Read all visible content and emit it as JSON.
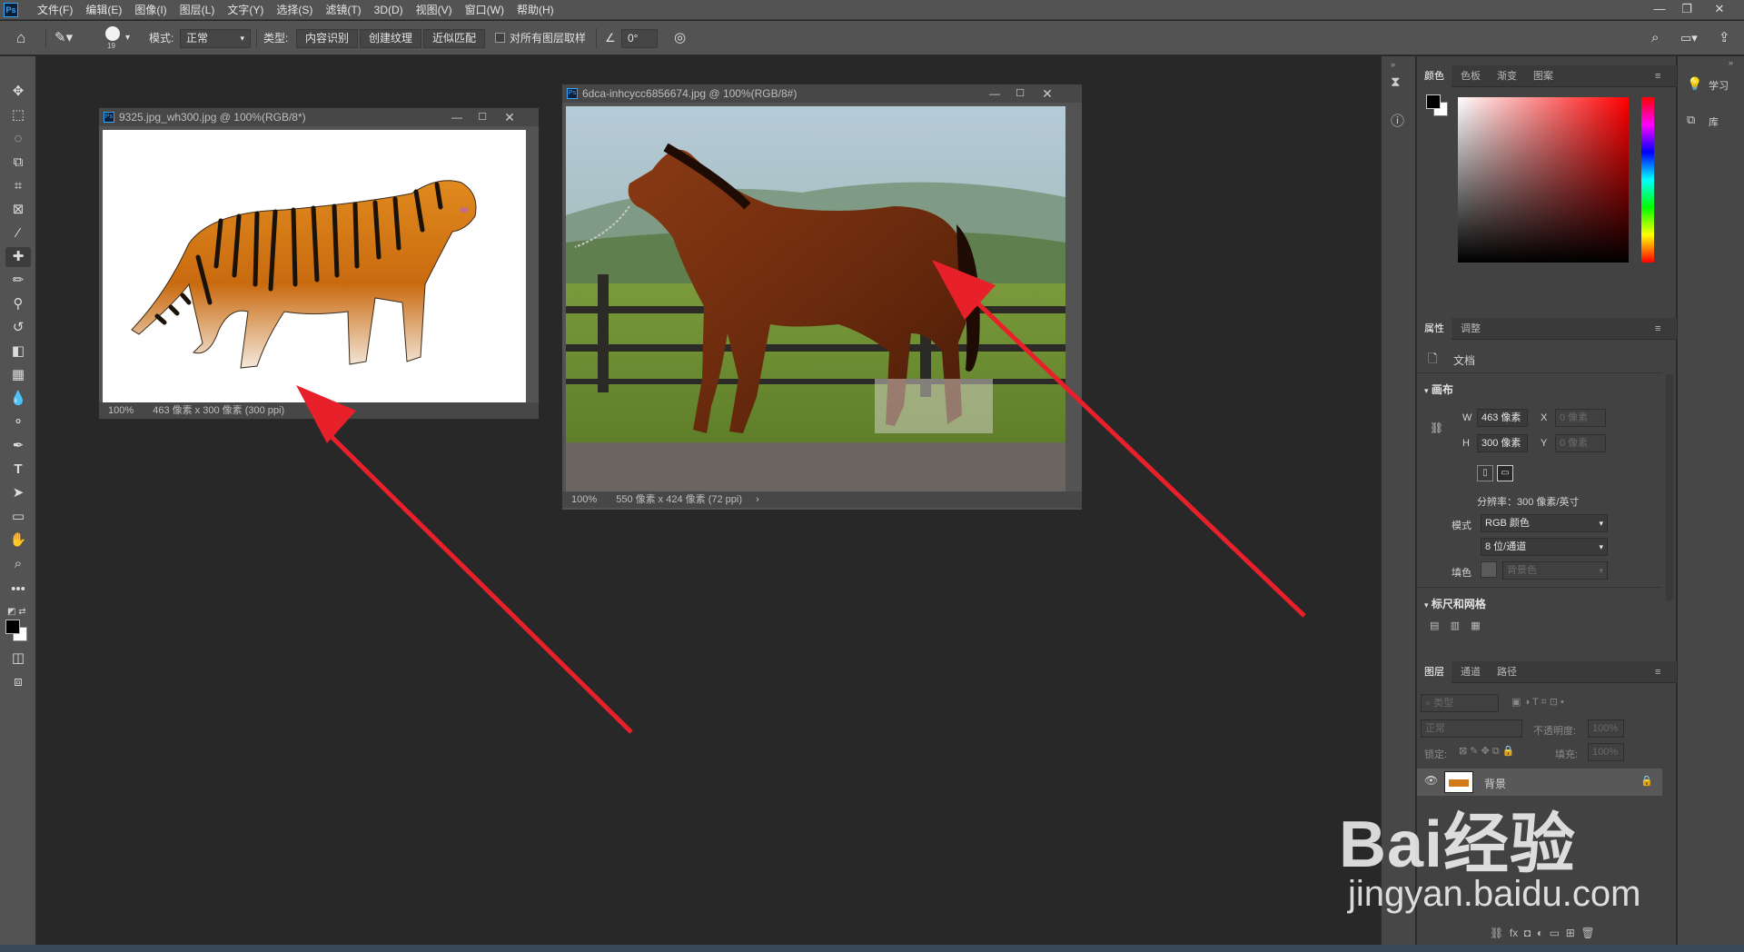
{
  "menubar": {
    "logo": "Ps",
    "items": [
      "文件(F)",
      "编辑(E)",
      "图像(I)",
      "图层(L)",
      "文字(Y)",
      "选择(S)",
      "滤镜(T)",
      "3D(D)",
      "视图(V)",
      "窗口(W)",
      "帮助(H)"
    ],
    "window_controls": [
      "—",
      "❐",
      "✕"
    ]
  },
  "options": {
    "brush_size": "19",
    "mode_label": "模式:",
    "mode_value": "正常",
    "type_label": "类型:",
    "type_buttons": [
      "内容识别",
      "创建纹理",
      "近似匹配"
    ],
    "sample_all_layers": "对所有图层取样",
    "angle_value": "0°"
  },
  "documents": [
    {
      "title": "9325.jpg_wh300.jpg @ 100%(RGB/8*)",
      "zoom": "100%",
      "info": "463 像素 x 300 像素 (300 ppi)",
      "image_icon": "tiger-image"
    },
    {
      "title": "6dca-inhcycc6856674.jpg @ 100%(RGB/8#)",
      "zoom": "100%",
      "info": "550 像素 x 424 像素 (72 ppi)",
      "image_icon": "horse-image"
    }
  ],
  "color_panel": {
    "tabs": [
      "颜色",
      "色板",
      "渐变",
      "图案"
    ],
    "foreground": "#000000",
    "background": "#ffffff",
    "hue": "#ff0000"
  },
  "properties_panel": {
    "tabs": [
      "属性",
      "调整"
    ],
    "doc_label": "文档",
    "canvas_header": "画布",
    "w_label": "W",
    "w_value": "463 像素",
    "h_label": "H",
    "h_value": "300 像素",
    "x_label": "X",
    "x_placeholder": "0 像素",
    "y_label": "Y",
    "y_placeholder": "0 像素",
    "resolution": "分辨率：300 像素/英寸",
    "mode_label": "模式",
    "mode_value": "RGB 颜色",
    "depth_value": "8 位/通道",
    "fill_label": "填色",
    "fill_value": "背景色",
    "rulers_header": "标尺和网格"
  },
  "layers_panel": {
    "tabs": [
      "图层",
      "通道",
      "路径"
    ],
    "filter_placeholder": "类型",
    "blend_mode": "正常",
    "opacity_label": "不透明度:",
    "opacity_value": "100%",
    "lock_label": "锁定:",
    "fill_label": "填充:",
    "fill_value": "100%",
    "layer_name": "背景"
  },
  "right_strip": {
    "learn_label": "学习",
    "library_label": "库"
  },
  "watermark": {
    "brand": "Bai经验",
    "url": "jingyan.baidu.com"
  },
  "colors": {
    "accent": "#31a8ff",
    "arrow": "#e8202a"
  }
}
